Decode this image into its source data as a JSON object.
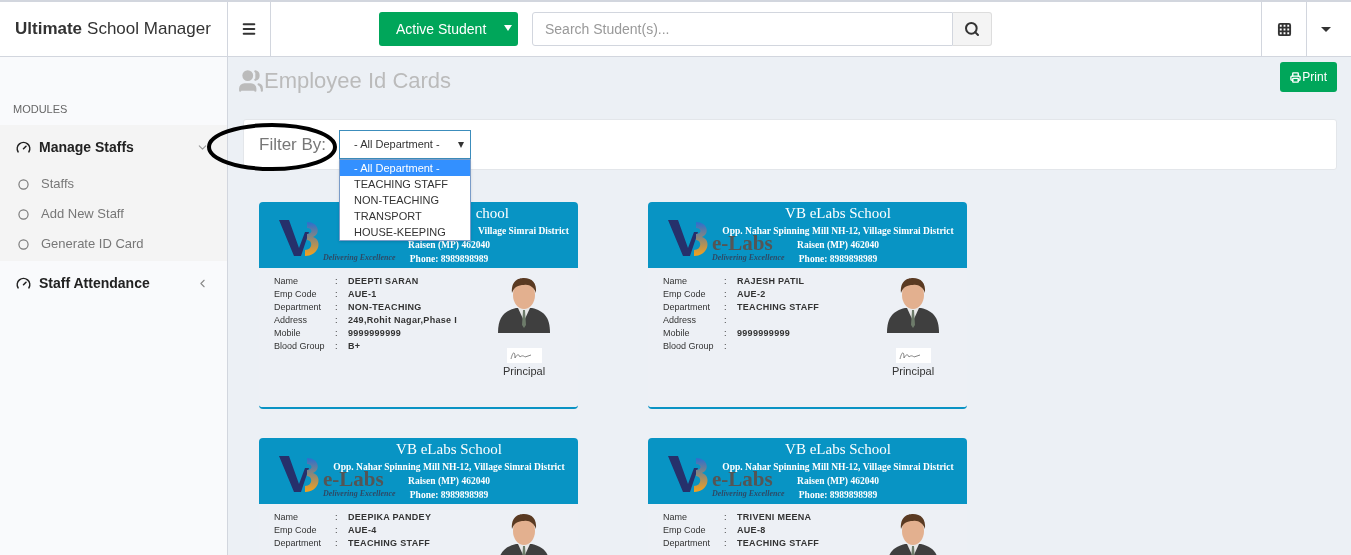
{
  "brand": {
    "bold": "Ultimate",
    "rest": "School Manager"
  },
  "header": {
    "active_button": "Active Student",
    "search": {
      "placeholder": "Search Student(s)..."
    }
  },
  "sidebar": {
    "heading": "MODULES",
    "items": [
      {
        "label": "Manage Staffs",
        "expanded": true,
        "children": [
          {
            "label": "Staffs"
          },
          {
            "label": "Add New Staff"
          },
          {
            "label": "Generate ID Card"
          }
        ]
      },
      {
        "label": "Staff Attendance",
        "expanded": false
      }
    ]
  },
  "page": {
    "title": "Employee Id Cards",
    "print_button": "Print"
  },
  "filter": {
    "label": "Filter By:",
    "select_value": "- All Department -",
    "open": true,
    "options": [
      {
        "label": "- All Department -",
        "selected": true
      },
      {
        "label": "TEACHING STAFF",
        "selected": false
      },
      {
        "label": "NON-TEACHING",
        "selected": false
      },
      {
        "label": "TRANSPORT",
        "selected": false
      },
      {
        "label": "HOUSE-KEEPING",
        "selected": false
      }
    ]
  },
  "cards": [
    {
      "covered": true,
      "separator": ":",
      "school": {
        "name": "chool",
        "address": "Village Simrai District",
        "city": "Raisen (MP) 462040",
        "phone": "Phone: 8989898989"
      },
      "logo": {
        "tagline": "Delivering Excellence"
      },
      "fields": [
        {
          "label": "Name",
          "value": "DEEPTI SARAN"
        },
        {
          "label": "Emp Code",
          "value": "AUE-1"
        },
        {
          "label": "Department",
          "value": "NON-TEACHING"
        },
        {
          "label": "Address",
          "value": "249,Rohit Nagar,Phase I"
        },
        {
          "label": "Mobile",
          "value": "9999999999"
        },
        {
          "label": "Blood Group",
          "value": "B+"
        }
      ],
      "signature_label": "Principal"
    },
    {
      "covered": false,
      "school": {
        "name": "VB eLabs School",
        "address": "Opp. Nahar Spinning Mill NH-12, Village Simrai District",
        "city": "Raisen (MP) 462040",
        "phone": "Phone: 8989898989"
      },
      "logo": {
        "text": "e-Labs",
        "tagline": "Delivering Excellence"
      },
      "separator": ":",
      "fields": [
        {
          "label": "Name",
          "value": "RAJESH PATIL"
        },
        {
          "label": "Emp Code",
          "value": "AUE-2"
        },
        {
          "label": "Department",
          "value": "TEACHING STAFF"
        },
        {
          "label": "Address"
        },
        {
          "label": "Mobile",
          "value": "9999999999"
        },
        {
          "label": "Blood Group"
        }
      ],
      "signature_label": "Principal"
    },
    {
      "covered": false,
      "school": {
        "name": "VB eLabs School",
        "address": "Opp. Nahar Spinning Mill NH-12, Village Simrai District",
        "city": "Raisen (MP) 462040",
        "phone": "Phone: 8989898989"
      },
      "logo": {
        "text": "e-Labs",
        "tagline": "Delivering Excellence"
      },
      "separator": ":",
      "fields": [
        {
          "label": "Name",
          "value": "DEEPIKA PANDEY"
        },
        {
          "label": "Emp Code",
          "value": "AUE-4"
        },
        {
          "label": "Department",
          "value": "TEACHING STAFF"
        }
      ]
    },
    {
      "covered": false,
      "school": {
        "name": "VB eLabs School",
        "address": "Opp. Nahar Spinning Mill NH-12, Village Simrai District",
        "city": "Raisen (MP) 462040",
        "phone": "Phone: 8989898989"
      },
      "logo": {
        "text": "e-Labs",
        "tagline": "Delivering Excellence"
      },
      "separator": ":",
      "fields": [
        {
          "label": "Name",
          "value": "TRIVENI MEENA"
        },
        {
          "label": "Emp Code",
          "value": "AUE-8"
        },
        {
          "label": "Department",
          "value": "TEACHING STAFF"
        }
      ]
    }
  ]
}
